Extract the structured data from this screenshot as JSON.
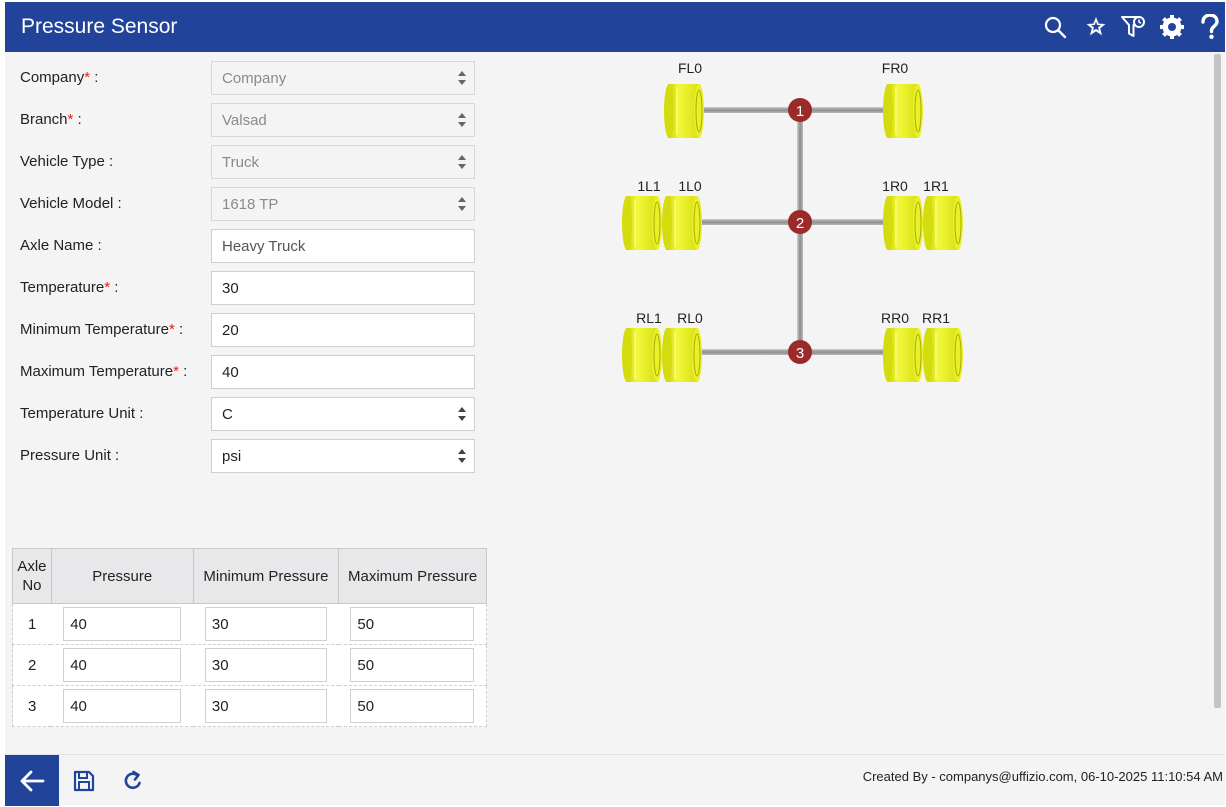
{
  "header": {
    "title": "Pressure Sensor",
    "icons": [
      "search-icon",
      "star-icon",
      "filter-icon",
      "gear-icon",
      "help-icon"
    ]
  },
  "form": {
    "company": {
      "label": "Company",
      "required": "*",
      "suffix": " :",
      "value": "Company"
    },
    "branch": {
      "label": "Branch",
      "required": "*",
      "suffix": " :",
      "value": "Valsad"
    },
    "vehicle_type": {
      "label": "Vehicle Type :",
      "value": "Truck"
    },
    "vehicle_model": {
      "label": "Vehicle Model :",
      "value": "1618 TP"
    },
    "axle_name": {
      "label": "Axle Name :",
      "value": "Heavy Truck"
    },
    "temperature": {
      "label": "Temperature",
      "required": "*",
      "suffix": " :",
      "value": "30"
    },
    "min_temperature": {
      "label": "Minimum Temperature",
      "required": "*",
      "suffix": " :",
      "value": "20"
    },
    "max_temperature": {
      "label": "Maximum Temperature",
      "required": "*",
      "suffix": " :",
      "value": "40"
    },
    "temperature_unit": {
      "label": "Temperature Unit :",
      "value": "C"
    },
    "pressure_unit": {
      "label": "Pressure Unit :",
      "value": "psi"
    }
  },
  "table": {
    "headers": {
      "axle_no": "Axle No",
      "pressure": "Pressure",
      "min_pressure": "Minimum Pressure",
      "max_pressure": "Maximum Pressure"
    },
    "rows": [
      {
        "axle": "1",
        "pressure": "40",
        "min": "30",
        "max": "50"
      },
      {
        "axle": "2",
        "pressure": "40",
        "min": "30",
        "max": "50"
      },
      {
        "axle": "3",
        "pressure": "40",
        "min": "30",
        "max": "50"
      }
    ]
  },
  "diagram": {
    "axle_numbers": [
      "1",
      "2",
      "3"
    ],
    "tyres": {
      "FL0": "FL0",
      "FR0": "FR0",
      "1L1": "1L1",
      "1L0": "1L0",
      "1R0": "1R0",
      "1R1": "1R1",
      "RL1": "RL1",
      "RL0": "RL0",
      "RR0": "RR0",
      "RR1": "RR1"
    },
    "tyre_color": "#e6ee1c",
    "axle_marker_color": "#9b2a2a"
  },
  "footer": {
    "created_by": "Created By - companys@uffizio.com, 06-10-2025 11:10:54 AM",
    "buttons": [
      "back-arrow-icon",
      "save-icon",
      "refresh-icon"
    ]
  },
  "colors": {
    "brand": "#21449a",
    "required": "#e02020"
  }
}
